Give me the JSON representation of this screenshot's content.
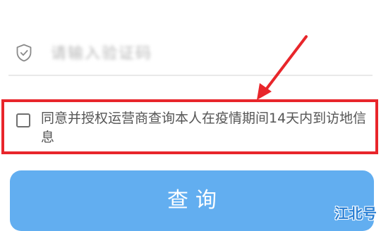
{
  "form": {
    "code_placeholder": "请输入验证码",
    "consent_text": "同意并授权运营商查询本人在疫情期间14天内到访地信息",
    "consent_checked": false,
    "submit_label": "查询"
  },
  "annotation": {
    "highlight_color": "#e8262b"
  },
  "watermark": {
    "text": "江北号"
  },
  "colors": {
    "button": "#62aef0",
    "watermark": "#2a7fd4"
  },
  "icons": [
    "shield-check-icon",
    "checkbox"
  ]
}
